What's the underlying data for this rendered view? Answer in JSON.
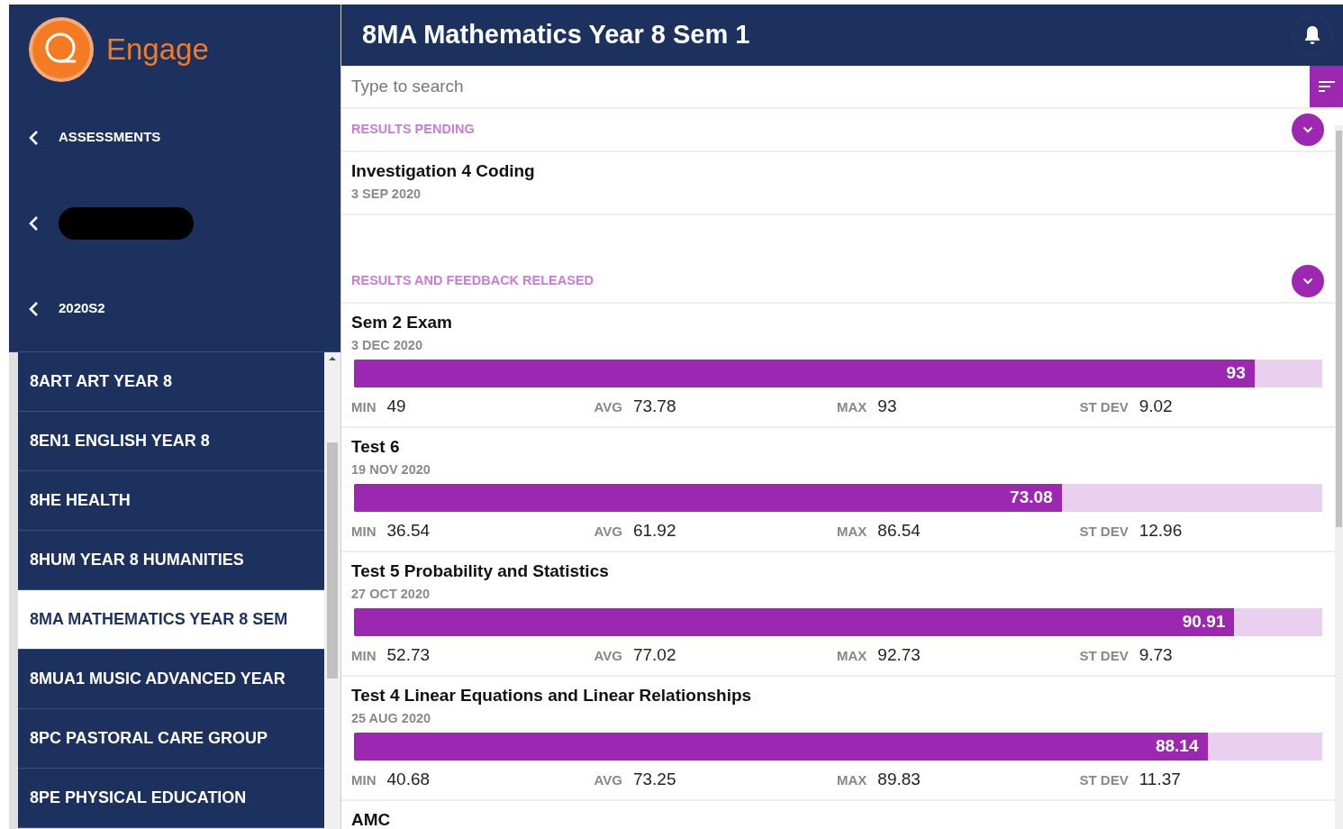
{
  "app": {
    "name": "Engage"
  },
  "sidebar": {
    "breadcrumbs": [
      {
        "label": "ASSESSMENTS",
        "redacted": false
      },
      {
        "redacted": true
      },
      {
        "label": "2020S2",
        "redacted": false
      }
    ],
    "courses": [
      {
        "label": "8ART ART YEAR 8",
        "selected": false
      },
      {
        "label": "8EN1 ENGLISH YEAR 8",
        "selected": false
      },
      {
        "label": "8HE HEALTH",
        "selected": false
      },
      {
        "label": "8HUM YEAR 8 HUMANITIES",
        "selected": false
      },
      {
        "label": "8MA MATHEMATICS YEAR 8 SEM",
        "selected": true
      },
      {
        "label": "8MUA1 MUSIC ADVANCED YEAR",
        "selected": false
      },
      {
        "label": "8PC PASTORAL CARE GROUP",
        "selected": false
      },
      {
        "label": "8PE PHYSICAL EDUCATION",
        "selected": false
      }
    ]
  },
  "header": {
    "title": "8MA Mathematics Year 8 Sem 1"
  },
  "search": {
    "placeholder": "Type to search"
  },
  "sections": [
    {
      "title": "RESULTS PENDING",
      "items": [
        {
          "title": "Investigation 4 Coding",
          "date": "3 SEP 2020"
        }
      ]
    },
    {
      "title": "RESULTS AND FEEDBACK RELEASED",
      "items": [
        {
          "title": "Sem 2 Exam",
          "date": "3 DEC 2020",
          "score": "93",
          "level": 0.93,
          "stats": [
            {
              "label": "MIN",
              "value": "49"
            },
            {
              "label": "AVG",
              "value": "73.78"
            },
            {
              "label": "MAX",
              "value": "93"
            },
            {
              "label": "ST DEV",
              "value": "9.02"
            }
          ]
        },
        {
          "title": "Test 6",
          "date": "19 NOV 2020",
          "score": "73.08",
          "level": 0.7308,
          "stats": [
            {
              "label": "MIN",
              "value": "36.54"
            },
            {
              "label": "AVG",
              "value": "61.92"
            },
            {
              "label": "MAX",
              "value": "86.54"
            },
            {
              "label": "ST DEV",
              "value": "12.96"
            }
          ]
        },
        {
          "title": "Test 5 Probability and Statistics",
          "date": "27 OCT 2020",
          "score": "90.91",
          "level": 0.9091,
          "stats": [
            {
              "label": "MIN",
              "value": "52.73"
            },
            {
              "label": "AVG",
              "value": "77.02"
            },
            {
              "label": "MAX",
              "value": "92.73"
            },
            {
              "label": "ST DEV",
              "value": "9.73"
            }
          ]
        },
        {
          "title": "Test 4 Linear Equations and Linear Relationships",
          "date": "25 AUG 2020",
          "score": "88.14",
          "level": 0.8814,
          "stats": [
            {
              "label": "MIN",
              "value": "40.68"
            },
            {
              "label": "AVG",
              "value": "73.25"
            },
            {
              "label": "MAX",
              "value": "89.83"
            },
            {
              "label": "ST DEV",
              "value": "11.37"
            }
          ]
        },
        {
          "title": "AMC"
        }
      ]
    }
  ]
}
